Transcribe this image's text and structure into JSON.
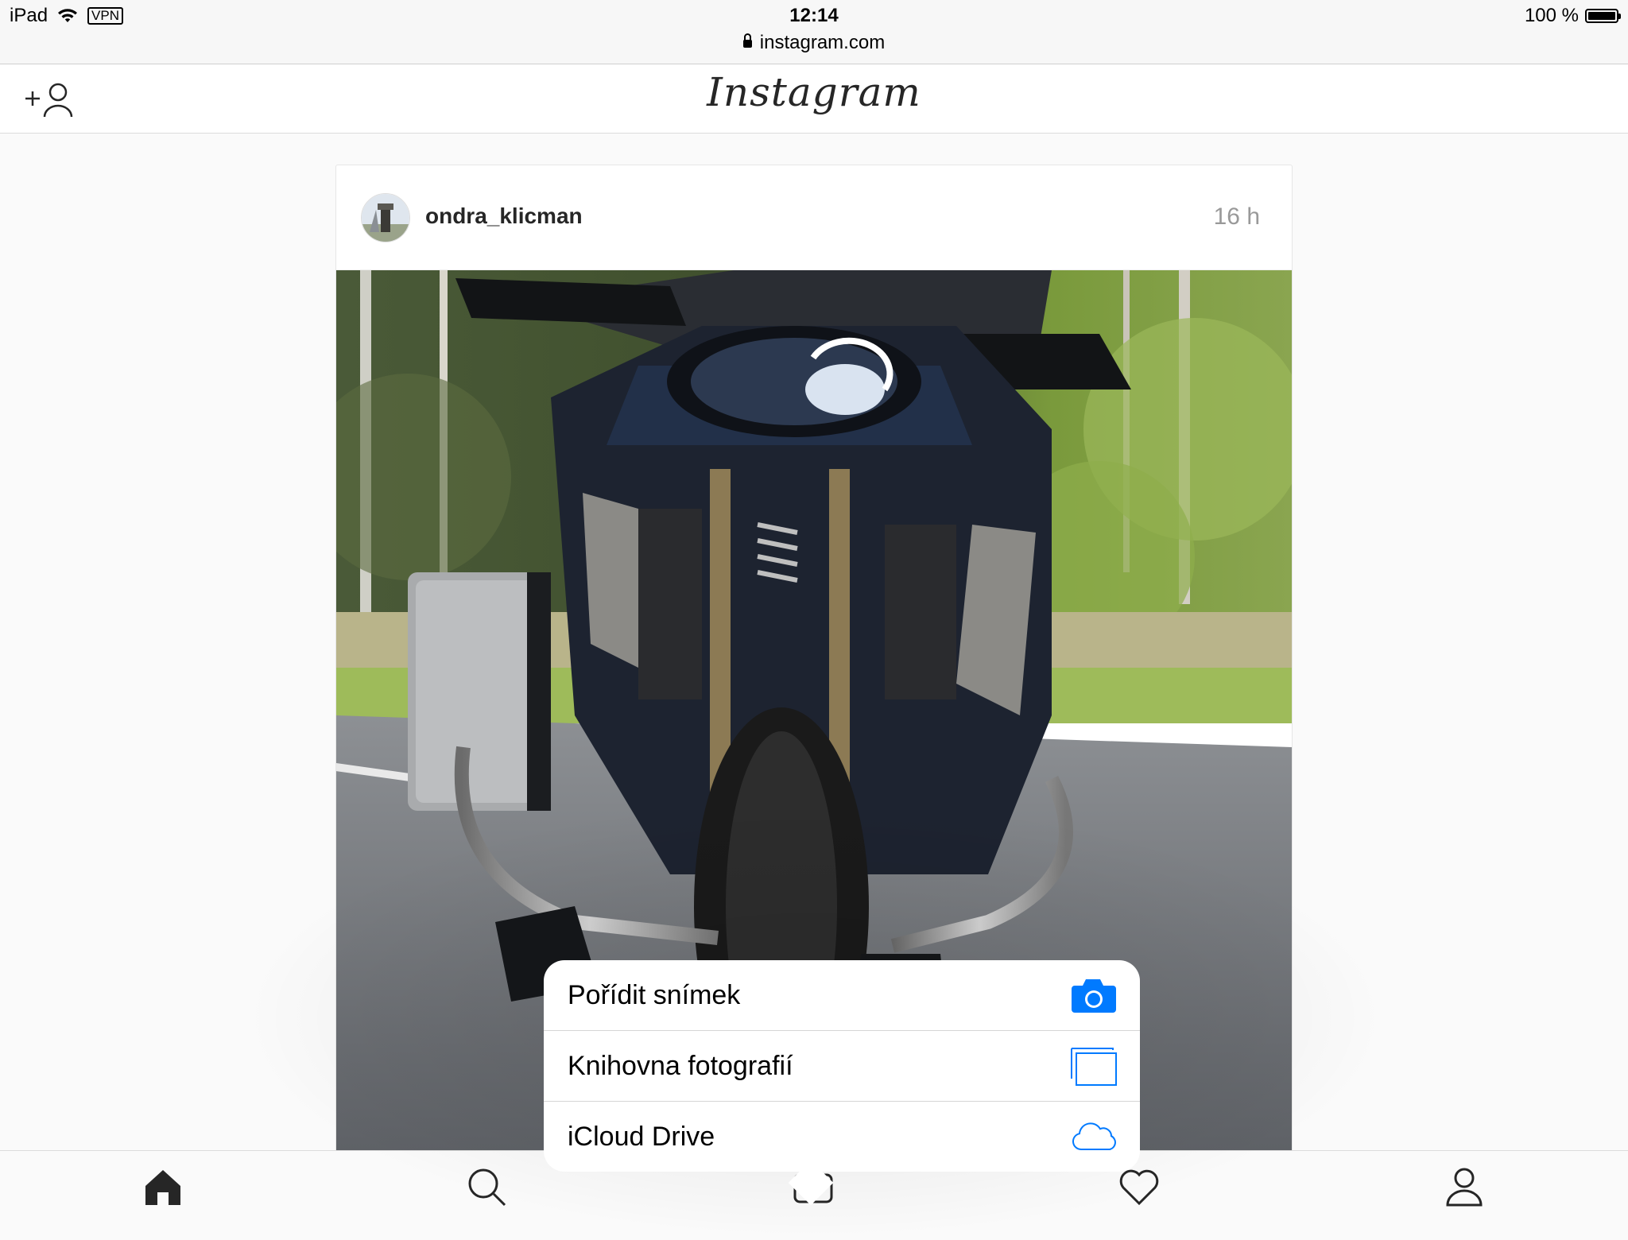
{
  "status_bar": {
    "device": "iPad",
    "vpn": "VPN",
    "time": "12:14",
    "url": "instagram.com",
    "battery": "100 %"
  },
  "header": {
    "logo": "Instagram",
    "add_user_icon": "add-user-icon"
  },
  "post": {
    "username": "ondra_klicman",
    "time_ago": "16 h"
  },
  "action_sheet": {
    "items": [
      {
        "label": "Pořídit snímek",
        "icon": "camera-icon"
      },
      {
        "label": "Knihovna fotografií",
        "icon": "photo-library-icon"
      },
      {
        "label": "iCloud Drive",
        "icon": "cloud-icon"
      }
    ],
    "accent": "#007aff"
  },
  "tab_bar": {
    "items": [
      "home-icon",
      "search-icon",
      "camera-icon",
      "heart-icon",
      "profile-icon"
    ],
    "active": "home-icon"
  }
}
